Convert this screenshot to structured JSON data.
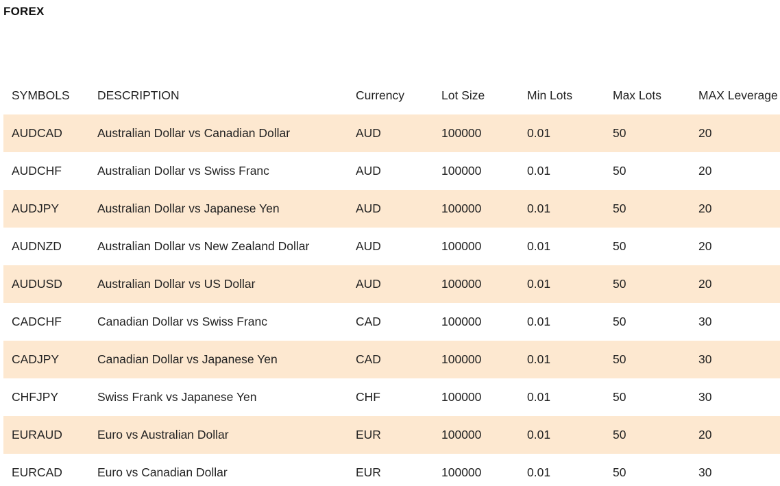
{
  "page": {
    "title": "FOREX"
  },
  "table": {
    "headers": [
      "SYMBOLS",
      "DESCRIPTION",
      "Currency",
      "Lot Size",
      "Min Lots",
      "Max Lots",
      "MAX Leverage"
    ],
    "rows": [
      [
        "AUDCAD",
        "Australian Dollar vs Canadian Dollar",
        "AUD",
        "100000",
        "0.01",
        "50",
        "20"
      ],
      [
        "AUDCHF",
        "Australian Dollar vs Swiss Franc",
        "AUD",
        "100000",
        "0.01",
        "50",
        "20"
      ],
      [
        "AUDJPY",
        "Australian Dollar vs Japanese Yen",
        "AUD",
        "100000",
        "0.01",
        "50",
        "20"
      ],
      [
        "AUDNZD",
        "Australian Dollar vs New Zealand Dollar",
        "AUD",
        "100000",
        "0.01",
        "50",
        "20"
      ],
      [
        "AUDUSD",
        "Australian Dollar vs US Dollar",
        "AUD",
        "100000",
        "0.01",
        "50",
        "20"
      ],
      [
        "CADCHF",
        "Canadian Dollar vs Swiss Franc",
        "CAD",
        "100000",
        "0.01",
        "50",
        "30"
      ],
      [
        "CADJPY",
        "Canadian Dollar vs Japanese Yen",
        "CAD",
        "100000",
        "0.01",
        "50",
        "30"
      ],
      [
        "CHFJPY",
        "Swiss Frank vs Japanese Yen",
        "CHF",
        "100000",
        "0.01",
        "50",
        "30"
      ],
      [
        "EURAUD",
        "Euro vs Australian Dollar",
        "EUR",
        "100000",
        "0.01",
        "50",
        "20"
      ],
      [
        "EURCAD",
        "Euro vs Canadian Dollar",
        "EUR",
        "100000",
        "0.01",
        "50",
        "30"
      ]
    ]
  },
  "colors": {
    "stripe": "#fde8d0",
    "text": "#222222"
  }
}
